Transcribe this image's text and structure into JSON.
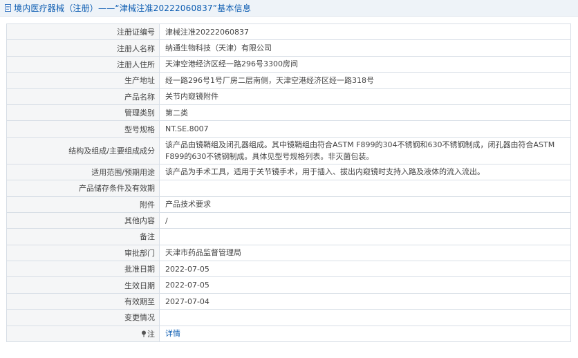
{
  "header": {
    "title": "境内医疗器械（注册）——“津械注准20222060837”基本信息"
  },
  "rows": [
    {
      "label": "注册证编号",
      "value": "津械注准20222060837"
    },
    {
      "label": "注册人名称",
      "value": "纳通生物科技（天津）有限公司"
    },
    {
      "label": "注册人住所",
      "value": "天津空港经济区经一路296号3300房间"
    },
    {
      "label": "生产地址",
      "value": "经一路296号1号厂房二层南侧，天津空港经济区经一路318号"
    },
    {
      "label": "产品名称",
      "value": "关节内窥镜附件"
    },
    {
      "label": "管理类别",
      "value": "第二类"
    },
    {
      "label": "型号规格",
      "value": "NT.SE.8007"
    },
    {
      "label": "结构及组成/主要组成成分",
      "value": "该产品由镜鞘组及闭孔器组成。其中镜鞘组由符合ASTM F899的304不锈钢和630不锈钢制成，闭孔器由符合ASTM F899的630不锈钢制成。具体见型号规格列表。非灭菌包装。"
    },
    {
      "label": "适用范围/预期用途",
      "value": "该产品为手术工具，适用于关节镜手术，用于插入、拔出内窥镜时支持入路及液体的流入流出。"
    },
    {
      "label": "产品储存条件及有效期",
      "value": ""
    },
    {
      "label": "附件",
      "value": "产品技术要求"
    },
    {
      "label": "其他内容",
      "value": "/"
    },
    {
      "label": "备注",
      "value": ""
    },
    {
      "label": "审批部门",
      "value": "天津市药品监督管理局"
    },
    {
      "label": "批准日期",
      "value": "2022-07-05"
    },
    {
      "label": "生效日期",
      "value": "2022-07-05"
    },
    {
      "label": "有效期至",
      "value": "2027-07-04"
    },
    {
      "label": "变更情况",
      "value": ""
    }
  ],
  "footer_row": {
    "label": "注",
    "icon": "pin-icon",
    "link_text": "详情"
  }
}
